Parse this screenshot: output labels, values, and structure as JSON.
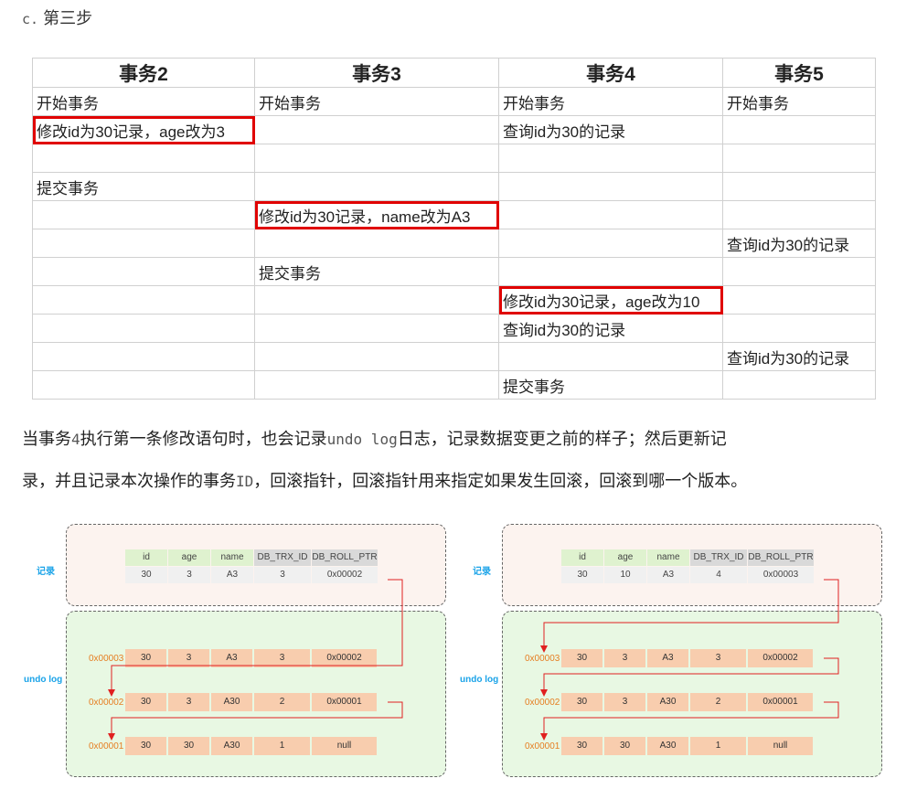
{
  "step": {
    "prefix": "c.",
    "title": "第三步"
  },
  "tx_table": {
    "headers": [
      "事务2",
      "事务3",
      "事务4",
      "事务5"
    ],
    "rows": [
      [
        "开始事务",
        "开始事务",
        "开始事务",
        "开始事务"
      ],
      [
        "修改id为30记录，age改为3",
        "",
        "查询id为30的记录",
        ""
      ],
      [
        "",
        "",
        "",
        ""
      ],
      [
        "提交事务",
        "",
        "",
        ""
      ],
      [
        "",
        "修改id为30记录，name改为A3",
        "",
        ""
      ],
      [
        "",
        "",
        "",
        "查询id为30的记录"
      ],
      [
        "",
        "提交事务",
        "",
        ""
      ],
      [
        "",
        "",
        "修改id为30记录，age改为10",
        ""
      ],
      [
        "",
        "",
        "查询id为30的记录",
        ""
      ],
      [
        "",
        "",
        "",
        "查询id为30的记录"
      ],
      [
        "",
        "",
        "提交事务",
        ""
      ]
    ],
    "highlight_color": "#e00000"
  },
  "description": {
    "line1_a": "当事务",
    "line1_b": "4",
    "line1_c": "执行第一条修改语句时，也会记录",
    "line1_d": "undo log",
    "line1_e": "日志，记录数据变更之前的样子；然后更新记",
    "line2_a": "录，并且记录本次操作的事务",
    "line2_b": "ID",
    "line2_c": "，回滚指针，回滚指针用来指定如果发生回滚，回滚到哪一个版本。"
  },
  "diagram_left": {
    "record_label": "记录",
    "undo_label": "undo log",
    "columns": [
      "id",
      "age",
      "name",
      "DB_TRX_ID",
      "DB_ROLL_PTR"
    ],
    "record": [
      "30",
      "3",
      "A3",
      "3",
      "0x00002"
    ],
    "undo_rows": [
      {
        "addr": "0x00003",
        "values": [
          "30",
          "3",
          "A3",
          "3",
          "0x00002"
        ]
      },
      {
        "addr": "0x00002",
        "values": [
          "30",
          "3",
          "A30",
          "2",
          "0x00001"
        ]
      },
      {
        "addr": "0x00001",
        "values": [
          "30",
          "30",
          "A30",
          "1",
          "null"
        ]
      }
    ]
  },
  "diagram_right": {
    "record_label": "记录",
    "undo_label": "undo log",
    "columns": [
      "id",
      "age",
      "name",
      "DB_TRX_ID",
      "DB_ROLL_PTR"
    ],
    "record": [
      "30",
      "10",
      "A3",
      "4",
      "0x00003"
    ],
    "undo_rows": [
      {
        "addr": "0x00003",
        "values": [
          "30",
          "3",
          "A3",
          "3",
          "0x00002"
        ]
      },
      {
        "addr": "0x00002",
        "values": [
          "30",
          "3",
          "A30",
          "2",
          "0x00001"
        ]
      },
      {
        "addr": "0x00001",
        "values": [
          "30",
          "30",
          "A30",
          "1",
          "null"
        ]
      }
    ]
  },
  "colors": {
    "record_bg": "#fcf3ef",
    "undo_bg": "#e8f8e3",
    "header_green": "#dff2cf",
    "header_gray": "#d9d9d9",
    "undo_cell": "#f8cdae",
    "arrow": "#e02020",
    "label_blue": "#1aa3e8",
    "addr_orange": "#e67e22"
  }
}
